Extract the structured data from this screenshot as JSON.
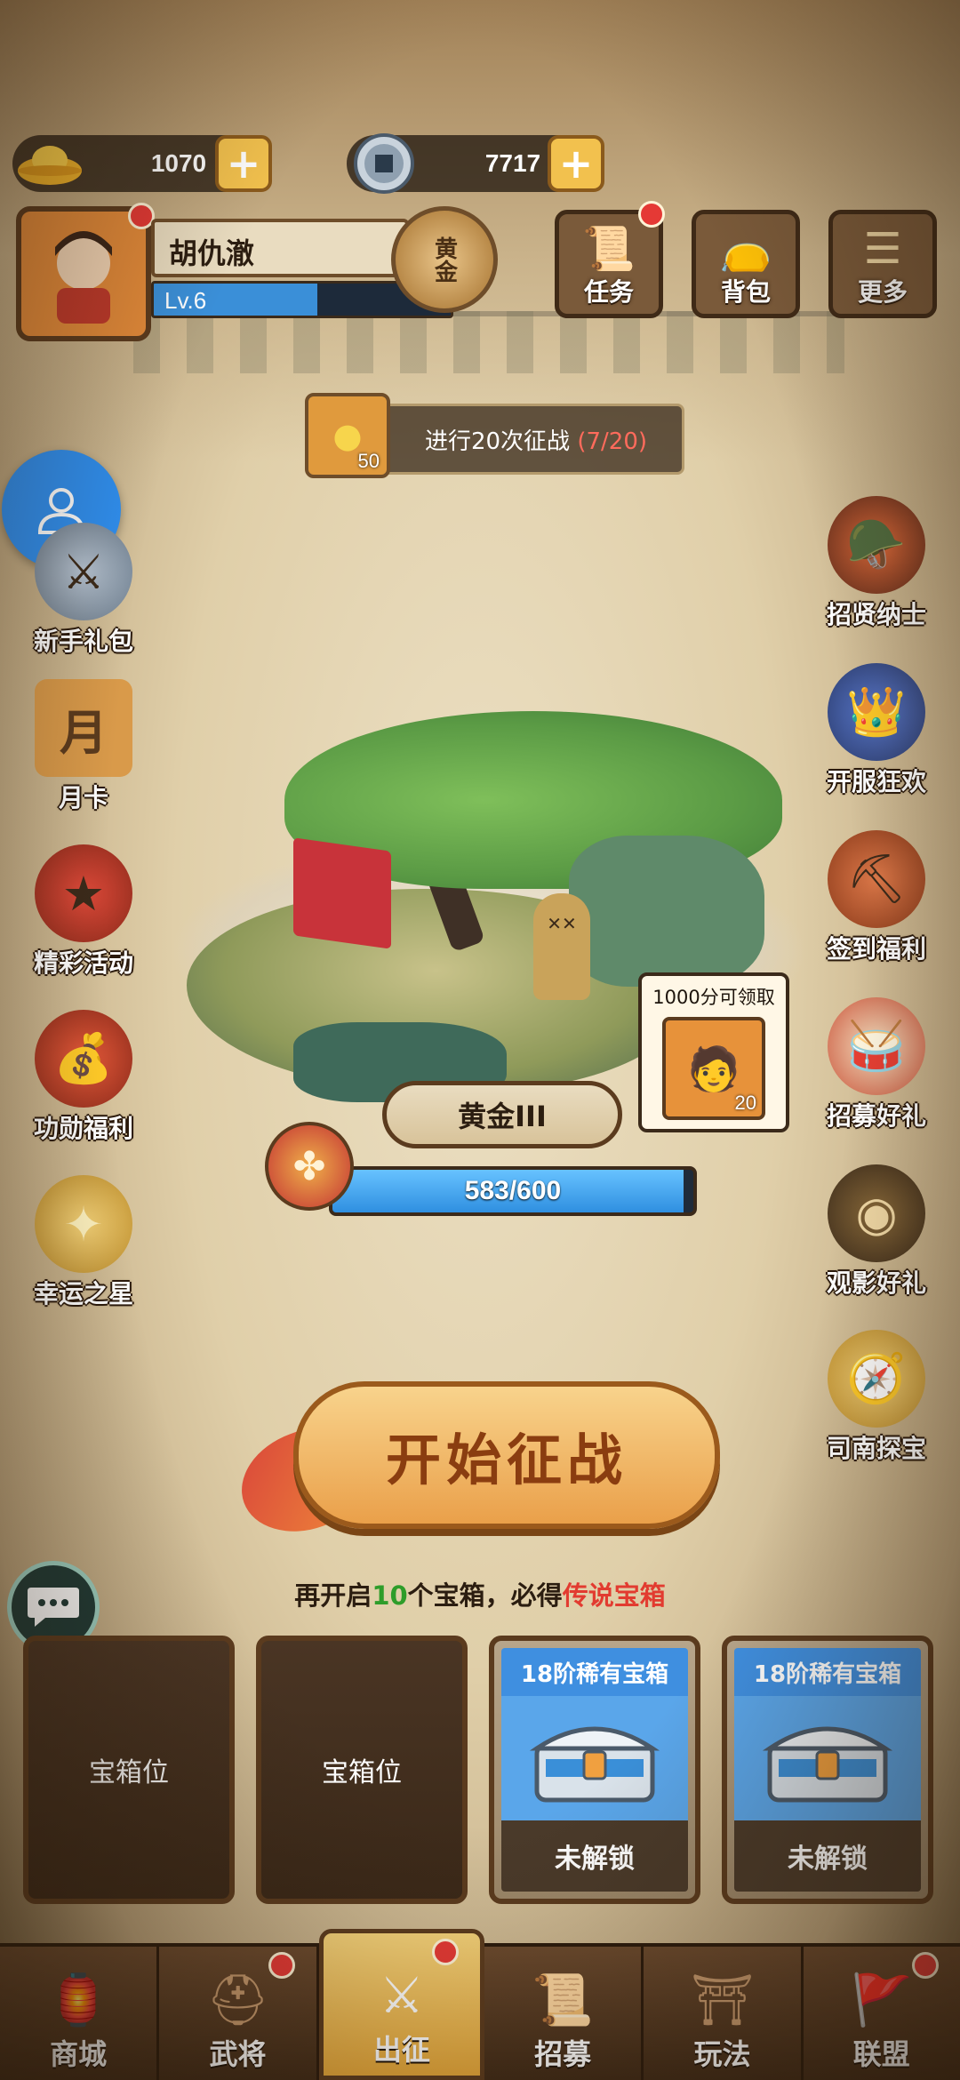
{
  "currency": {
    "gold": {
      "value": "1070",
      "icon": "gold-ingot-icon"
    },
    "coin": {
      "value": "7717",
      "icon": "copper-coin-icon"
    }
  },
  "profile": {
    "name": "胡仇澈",
    "level": "Lv.6",
    "level_progress": 0.55,
    "rank_emblem": "黄金"
  },
  "top_buttons": [
    {
      "label": "任务",
      "icon": "scroll-icon",
      "badge": true
    },
    {
      "label": "背包",
      "icon": "bag-icon",
      "badge": false
    },
    {
      "label": "更多",
      "icon": "menu-icon",
      "badge": false
    }
  ],
  "quest": {
    "reward_count": "50",
    "text": "进行20次征战",
    "progress": "(7/20)"
  },
  "left_events": [
    {
      "label": "新手礼包",
      "icon": "warrior-icon"
    },
    {
      "label": "月卡",
      "icon": "month-card-icon",
      "glyph": "月"
    },
    {
      "label": "精彩活动",
      "icon": "gift-bag-icon"
    },
    {
      "label": "功勋福利",
      "icon": "treasure-bag-icon"
    },
    {
      "label": "幸运之星",
      "icon": "star-icon"
    }
  ],
  "right_events": [
    {
      "label": "招贤纳士",
      "icon": "general-icon"
    },
    {
      "label": "开服狂欢",
      "icon": "strategist-icon"
    },
    {
      "label": "签到福利",
      "icon": "shovel-gold-icon"
    },
    {
      "label": "招募好礼",
      "icon": "drum-icon"
    },
    {
      "label": "观影好礼",
      "icon": "film-reel-icon"
    },
    {
      "label": "司南探宝",
      "icon": "compass-icon"
    }
  ],
  "battle": {
    "rank": "黄金III",
    "score": "583/600",
    "score_progress": 0.9717,
    "reward_bubble": {
      "title": "1000分可领取",
      "count": "20"
    }
  },
  "start_button": {
    "label": "开始征战"
  },
  "chest_tip": {
    "prefix": "再开启",
    "count": "10",
    "middle": "个宝箱，必得",
    "reward": "传说宝箱"
  },
  "chest_slots": [
    {
      "type": "empty",
      "label": "宝箱位"
    },
    {
      "type": "empty",
      "label": "宝箱位"
    },
    {
      "type": "locked",
      "title": "18阶稀有宝箱",
      "status": "未解锁"
    },
    {
      "type": "locked",
      "title": "18阶稀有宝箱",
      "status": "未解锁"
    }
  ],
  "bottom_nav": [
    {
      "label": "商城",
      "icon": "shop-icon",
      "badge": false,
      "active": false
    },
    {
      "label": "武将",
      "icon": "helmet-icon",
      "badge": true,
      "active": false
    },
    {
      "label": "出征",
      "icon": "battle-icon",
      "badge": true,
      "active": true
    },
    {
      "label": "招募",
      "icon": "recruit-scroll-icon",
      "badge": false,
      "active": false
    },
    {
      "label": "玩法",
      "icon": "pavilion-icon",
      "badge": false,
      "active": false
    },
    {
      "label": "联盟",
      "icon": "alliance-flag-icon",
      "badge": true,
      "active": false
    }
  ],
  "colors": {
    "accent_blue": "#2f8ff0",
    "badge_red": "#e53935",
    "tip_green": "#2e9d2a",
    "tip_red": "#e23b30"
  }
}
